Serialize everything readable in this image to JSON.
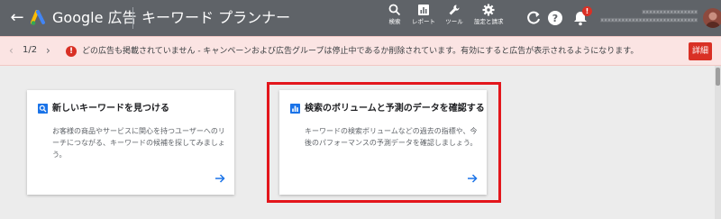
{
  "header": {
    "product_name": "Google 広告",
    "page_title": "キーワード プランナー",
    "tools": [
      {
        "label": "検索",
        "icon": "search-icon"
      },
      {
        "label": "レポート",
        "icon": "report-icon"
      },
      {
        "label": "ツール",
        "icon": "wrench-icon"
      },
      {
        "label": "設定と請求",
        "icon": "gear-icon"
      }
    ],
    "notification_count": "!",
    "account_line1": "xxxxxxxxxxxxxxxx",
    "account_line2": "xxxxxxxxxxxxxxxxxxxxxxxxxxxx"
  },
  "banner": {
    "page_indicator": "1/2",
    "alert_symbol": "!",
    "message": "どの広告も掲載されていません - キャンペーンおよび広告グループは停止中であるか削除されています。有効にすると広告が表示されるようになります。",
    "details_label": "詳細"
  },
  "cards": [
    {
      "title": "新しいキーワードを見つける",
      "description": "お客様の商品やサービスに関心を持つユーザーへのリーチにつながる、キーワードの候補を探してみましょう。",
      "icon": "search-icon"
    },
    {
      "title": "検索のボリュームと予測のデータを確認する",
      "description": "キーワードの検索ボリュームなどの過去の指標や、今後のパフォーマンスの予測データを確認しましょう。",
      "icon": "bar-chart-icon"
    }
  ],
  "colors": {
    "topbar": "#5f6368",
    "banner_bg": "#fbe4e3",
    "alert_red": "#d93025",
    "accent_blue": "#1a73e8",
    "highlight_red": "#e3161c"
  }
}
